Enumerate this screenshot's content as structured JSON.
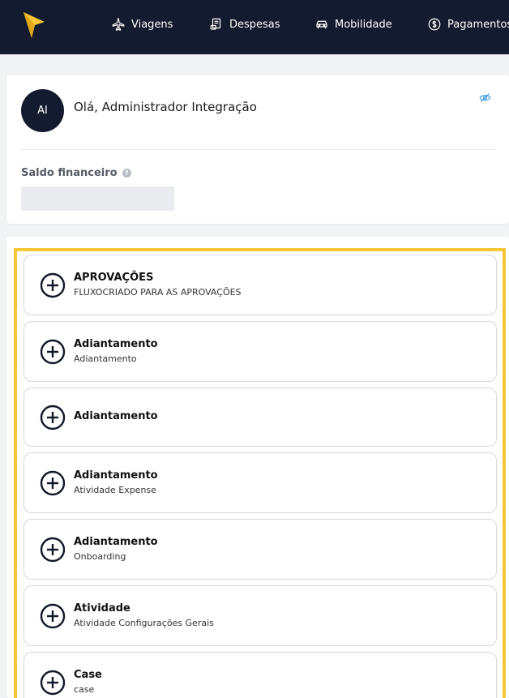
{
  "brand": {
    "logo": "logo-arrow-icon",
    "accent": "#f6c634",
    "dark": "#151b2e"
  },
  "nav": [
    {
      "label": "Viagens",
      "icon": "airplane-icon"
    },
    {
      "label": "Despesas",
      "icon": "receipt-icon"
    },
    {
      "label": "Mobilidade",
      "icon": "car-icon"
    },
    {
      "label": "Pagamentos",
      "icon": "dollar-coin-icon"
    }
  ],
  "profile": {
    "initials": "AI",
    "greeting": "Olá, Administrador Integração",
    "visibility_icon": "eye-off-icon",
    "balance_label": "Saldo financeiro",
    "help_icon": "help-icon"
  },
  "flows": [
    {
      "title": "APROVAÇÕES",
      "subtitle": "FLUXOCRIADO PARA AS APROVAÇÕES"
    },
    {
      "title": "Adiantamento",
      "subtitle": "Adiantamento"
    },
    {
      "title": "Adiantamento",
      "subtitle": ""
    },
    {
      "title": "Adiantamento",
      "subtitle": "Atividade Expense"
    },
    {
      "title": "Adiantamento",
      "subtitle": "Onboarding"
    },
    {
      "title": "Atividade",
      "subtitle": "Atividade Configurações Gerais"
    },
    {
      "title": "Case",
      "subtitle": "case"
    }
  ]
}
